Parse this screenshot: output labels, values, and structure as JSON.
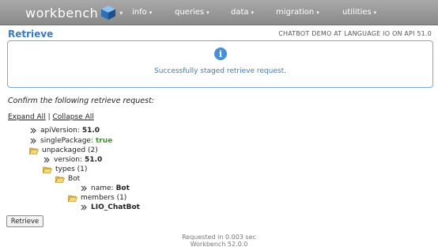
{
  "nav": {
    "brand": "workbench",
    "items": [
      {
        "label": "info"
      },
      {
        "label": "queries"
      },
      {
        "label": "data"
      },
      {
        "label": "migration"
      },
      {
        "label": "utilities"
      }
    ]
  },
  "header": {
    "title": "Retrieve",
    "org_info": "CHATBOT DEMO AT LANGUAGE IO ON API 51.0"
  },
  "alert": {
    "message": "Successfully staged retrieve request."
  },
  "confirm_text": "Confirm the following retrieve request:",
  "tree_controls": {
    "expand_all": "Expand All",
    "separator": "|",
    "collapse_all": "Collapse All"
  },
  "tree": {
    "api_version_key": "apiVersion:",
    "api_version_val": "51.0",
    "single_package_key": "singlePackage:",
    "single_package_val": "true",
    "unpackaged": "unpackaged (2)",
    "version_key": "version:",
    "version_val": "51.0",
    "types": "types (1)",
    "bot": "Bot",
    "name_key": "name:",
    "name_val": "Bot",
    "members": "members (1)",
    "member_val": "LIO_ChatBot"
  },
  "retrieve_button": "Retrieve",
  "footer": {
    "timing": "Requested in 0.003 sec",
    "version": "Workbench 52.0.0"
  },
  "colors": {
    "accent": "#3b7bbf",
    "true_value": "#3a9a23",
    "navbar": "#9a9a9a"
  }
}
